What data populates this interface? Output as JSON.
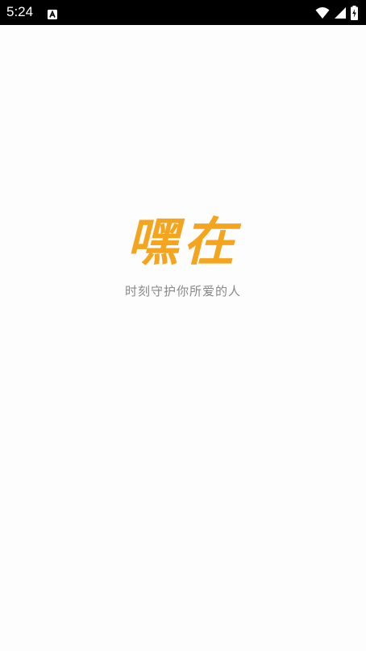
{
  "status_bar": {
    "time": "5:24",
    "left_icons": [
      "app-notification-icon"
    ],
    "right_icons": [
      "wifi-icon",
      "cellular-signal-icon",
      "battery-charging-icon"
    ],
    "background_color": "#000000",
    "foreground_color": "#ffffff"
  },
  "splash": {
    "logo_text": "嘿在",
    "logo_color": "#f5a41d",
    "tagline": "时刻守护你所爱的人",
    "tagline_color": "#888888",
    "background_color": "#fdfdfd"
  }
}
